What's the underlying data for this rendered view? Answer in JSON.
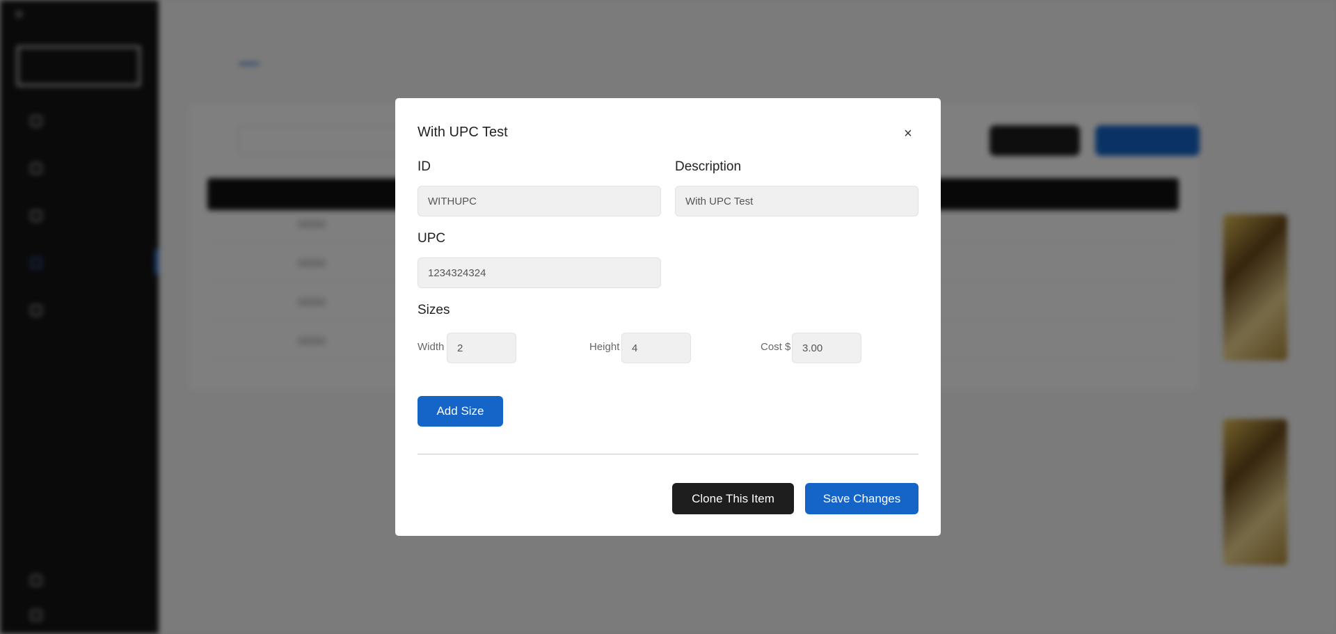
{
  "modal": {
    "title": "With UPC Test",
    "close_symbol": "×",
    "id_label": "ID",
    "id_value": "WITHUPC",
    "description_label": "Description",
    "description_value": "With UPC Test",
    "upc_label": "UPC",
    "upc_value": "1234324324",
    "sizes_label": "Sizes",
    "sizes": [
      {
        "width_label": "Width",
        "width_value": "2",
        "height_label": "Height",
        "height_value": "4",
        "cost_label": "Cost $",
        "cost_value": "3.00"
      }
    ],
    "add_size_label": "Add Size",
    "clone_label": "Clone This Item",
    "save_label": "Save Changes"
  },
  "colors": {
    "primary": "#1565c8",
    "dark_button": "#1e1e1e",
    "sidebar": "#141414",
    "overlay": "rgba(0,0,0,0.5)"
  },
  "icons": {
    "close": "close-icon"
  }
}
